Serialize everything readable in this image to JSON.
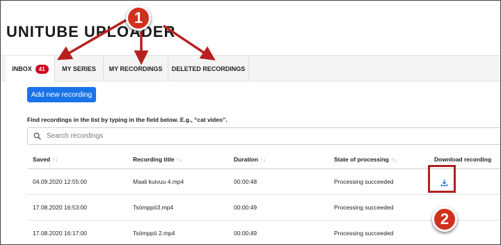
{
  "app": {
    "title": "UNITUBE UPLOADER"
  },
  "tabs": [
    {
      "label": "INBOX",
      "badge": "41",
      "active": true
    },
    {
      "label": "MY SERIES"
    },
    {
      "label": "MY RECORDINGS"
    },
    {
      "label": "DELETED RECORDINGS"
    }
  ],
  "actions": {
    "add_label": "Add new recording"
  },
  "search": {
    "hint": "Find recordings in the list by typing in the field below. E.g., “cat video”.",
    "placeholder": "Search recordings",
    "value": ""
  },
  "table": {
    "columns": [
      "Saved",
      "Recording title",
      "Duration",
      "State of processing",
      "Download recording"
    ],
    "sort_glyph": "↑↓",
    "rows": [
      {
        "saved": "04.09.2020 12:55:00",
        "title": "Maali kuivuu 4.mp4",
        "duration": "00:00:48",
        "state": "Processing succeeded",
        "download": true
      },
      {
        "saved": "17.08.2020 16:53:00",
        "title": "Tsömppö3.mp4",
        "duration": "00:00:49",
        "state": "Processing succeeded",
        "download": false
      },
      {
        "saved": "17.08.2020 16:17:00",
        "title": "Tsömppö 2.mp4",
        "duration": "00:00:49",
        "state": "Processing succeeded",
        "download": false
      }
    ]
  },
  "annotations": {
    "marker1": "1",
    "marker2": "2",
    "color": "#c62020"
  },
  "icons": {
    "search": "search-icon",
    "download": "download-icon",
    "sort": "sort-icon"
  },
  "colors": {
    "primary": "#1a73e8",
    "badge": "#d0021b",
    "annotation": "#c62020"
  }
}
